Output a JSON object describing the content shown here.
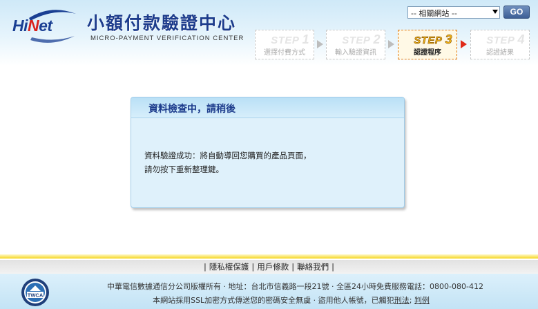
{
  "brand": {
    "logo_text": "HiNet",
    "site_title": "小額付款驗證中心",
    "site_subtitle": "MICRO-PAYMENT VERIFICATION CENTER"
  },
  "related_sites": {
    "selected": "-- 相關網站 --",
    "go_label": "GO"
  },
  "steps": [
    {
      "step": "STEP",
      "num": "1",
      "label": "選擇付費方式",
      "active": false
    },
    {
      "step": "STEP",
      "num": "2",
      "label": "輸入驗證資訊",
      "active": false
    },
    {
      "step": "STEP",
      "num": "3",
      "label": "認證程序",
      "active": true
    },
    {
      "step": "STEP",
      "num": "4",
      "label": "認證結果",
      "active": false
    }
  ],
  "main": {
    "title": "資料檢查中，請稍後",
    "message_line1": "資料驗證成功：將自動導回您購買的產品頁面，",
    "message_line2": "請勿按下重新整理鍵。"
  },
  "footer": {
    "links": [
      "隱私權保護",
      "用戶條款",
      "聯絡我們"
    ],
    "line1": "中華電信數據通信分公司版權所有 ‧ 地址：台北市信義路一段21號 ‧ 全區24小時免費服務電話：0800-080-412",
    "line2_prefix": "本網站採用SSL加密方式傳送您的密碼安全無虞 ‧ 盜用他人帳號，已觸犯",
    "line2_link1": "刑法",
    "line2_sep": "; ",
    "line2_link2": "判例",
    "twca_label": "TWCA"
  },
  "colors": {
    "brand_blue": "#1d3c8c",
    "brand_red": "#d9231e",
    "active_step": "#f2b415",
    "footer_yellow": "#f5d620"
  }
}
